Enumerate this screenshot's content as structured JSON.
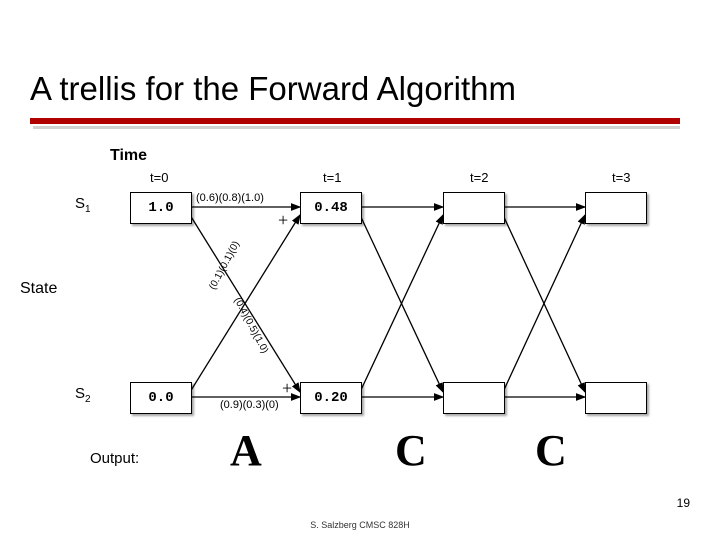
{
  "title": "A trellis for the Forward Algorithm",
  "labels": {
    "time": "Time",
    "state": "State",
    "output": "Output:",
    "s1": "S",
    "s1_sub": "1",
    "s2": "S",
    "s2_sub": "2",
    "t0": "t=0",
    "t1": "t=1",
    "t2": "t=2",
    "t3": "t=3",
    "plus": "+"
  },
  "nodes": {
    "r1c0": "1.0",
    "r1c1": "0.48",
    "r1c2": "",
    "r1c3": "",
    "r2c0": "0.0",
    "r2c1": "0.20",
    "r2c2": "",
    "r2c3": ""
  },
  "edge_labels": {
    "s1_s1": "(0.6)(0.8)(1.0)",
    "s2_s2": "(0.9)(0.3)(0)",
    "s2_s1": "(0.1)(0.1)(0)",
    "s1_s2": "(0.4)(0.5)(1.0)"
  },
  "outputs": {
    "o1": "A",
    "o2": "C",
    "o3": "C"
  },
  "footer": "S. Salzberg CMSC 828H",
  "slide_number": "19",
  "chart_data": {
    "type": "table",
    "description": "HMM forward-algorithm trellis",
    "states": [
      "S1",
      "S2"
    ],
    "time_steps": [
      0,
      1,
      2,
      3
    ],
    "outputs": [
      "A",
      "C",
      "C"
    ],
    "alpha": {
      "t0": {
        "S1": 1.0,
        "S2": 0.0
      },
      "t1": {
        "S1": 0.48,
        "S2": 0.2
      },
      "t2": {
        "S1": null,
        "S2": null
      },
      "t3": {
        "S1": null,
        "S2": null
      }
    },
    "edge_annotations_t0_t1": {
      "S1->S1": [
        0.6,
        0.8,
        1.0
      ],
      "S2->S1": [
        0.1,
        0.1,
        0.0
      ],
      "S1->S2": [
        0.4,
        0.5,
        1.0
      ],
      "S2->S2": [
        0.9,
        0.3,
        0.0
      ]
    }
  }
}
